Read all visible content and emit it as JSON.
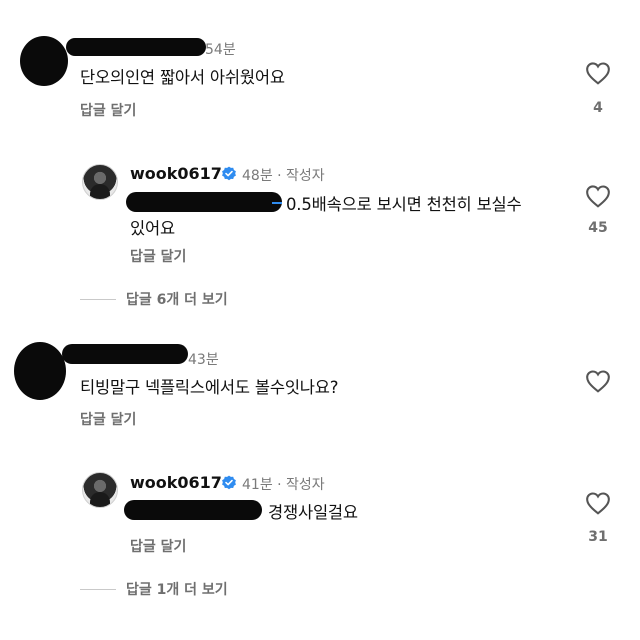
{
  "colors": {
    "verified": "#2f8cf0",
    "redaction": "#0a0a0a",
    "muted": "#7a7a7a"
  },
  "comments": [
    {
      "time": "54분",
      "text": "단오의인연 짧아서 아쉬웠어요",
      "reply_label": "답글 달기",
      "likes": "4",
      "reply": {
        "username": "wook0617",
        "time": "48분 · 작성자",
        "text_line1": "0.5배속으로 보시면 천천히 보실수",
        "text_line2": "있어요",
        "reply_label": "답글 달기",
        "likes": "45"
      },
      "view_more": "답글 6개 더 보기"
    },
    {
      "time": "43분",
      "text": "티빙말구 넥플릭스에서도 볼수잇나요?",
      "reply_label": "답글 달기",
      "likes": "",
      "reply": {
        "username": "wook0617",
        "time": "41분 · 작성자",
        "text_line1": "경쟁사일걸요",
        "text_line2": "",
        "reply_label": "답글 달기",
        "likes": "31"
      },
      "view_more": "답글 1개 더 보기"
    }
  ]
}
